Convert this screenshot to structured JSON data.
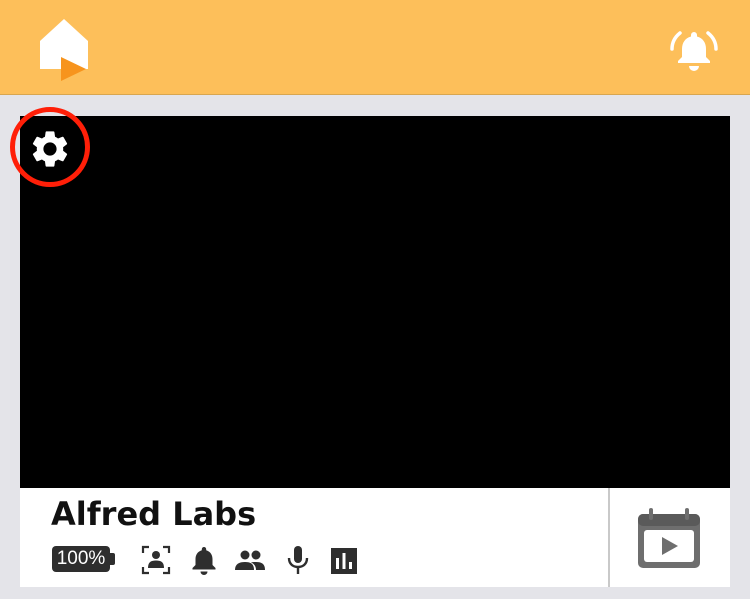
{
  "header": {
    "home_logo_icon": "home-play-logo-icon",
    "alarm_icon": "alarm-bell-icon"
  },
  "camera": {
    "name": "Alfred Labs",
    "settings_icon": "gear-icon",
    "battery": {
      "label": "100%",
      "percent": 100
    },
    "feature_icons": [
      "motion-detection-icon",
      "notification-bell-icon",
      "people-icon",
      "microphone-icon",
      "bar-chart-icon"
    ],
    "recordings_icon": "calendar-video-icon"
  },
  "colors": {
    "header_bg": "#fdbf5a",
    "page_bg": "#e4e4e9",
    "video_bg": "#000000",
    "highlight_ring": "#ff1f08",
    "logo_accent": "#f7941d",
    "icon_dark": "#2e2e2e"
  }
}
